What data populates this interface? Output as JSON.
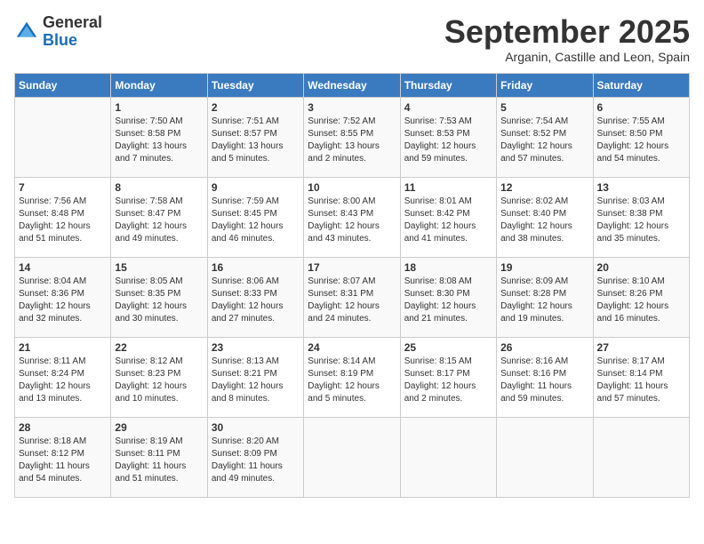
{
  "header": {
    "logo_general": "General",
    "logo_blue": "Blue",
    "month_title": "September 2025",
    "location": "Arganin, Castille and Leon, Spain"
  },
  "days_of_week": [
    "Sunday",
    "Monday",
    "Tuesday",
    "Wednesday",
    "Thursday",
    "Friday",
    "Saturday"
  ],
  "weeks": [
    [
      {
        "day": "",
        "content": ""
      },
      {
        "day": "1",
        "content": "Sunrise: 7:50 AM\nSunset: 8:58 PM\nDaylight: 13 hours\nand 7 minutes."
      },
      {
        "day": "2",
        "content": "Sunrise: 7:51 AM\nSunset: 8:57 PM\nDaylight: 13 hours\nand 5 minutes."
      },
      {
        "day": "3",
        "content": "Sunrise: 7:52 AM\nSunset: 8:55 PM\nDaylight: 13 hours\nand 2 minutes."
      },
      {
        "day": "4",
        "content": "Sunrise: 7:53 AM\nSunset: 8:53 PM\nDaylight: 12 hours\nand 59 minutes."
      },
      {
        "day": "5",
        "content": "Sunrise: 7:54 AM\nSunset: 8:52 PM\nDaylight: 12 hours\nand 57 minutes."
      },
      {
        "day": "6",
        "content": "Sunrise: 7:55 AM\nSunset: 8:50 PM\nDaylight: 12 hours\nand 54 minutes."
      }
    ],
    [
      {
        "day": "7",
        "content": "Sunrise: 7:56 AM\nSunset: 8:48 PM\nDaylight: 12 hours\nand 51 minutes."
      },
      {
        "day": "8",
        "content": "Sunrise: 7:58 AM\nSunset: 8:47 PM\nDaylight: 12 hours\nand 49 minutes."
      },
      {
        "day": "9",
        "content": "Sunrise: 7:59 AM\nSunset: 8:45 PM\nDaylight: 12 hours\nand 46 minutes."
      },
      {
        "day": "10",
        "content": "Sunrise: 8:00 AM\nSunset: 8:43 PM\nDaylight: 12 hours\nand 43 minutes."
      },
      {
        "day": "11",
        "content": "Sunrise: 8:01 AM\nSunset: 8:42 PM\nDaylight: 12 hours\nand 41 minutes."
      },
      {
        "day": "12",
        "content": "Sunrise: 8:02 AM\nSunset: 8:40 PM\nDaylight: 12 hours\nand 38 minutes."
      },
      {
        "day": "13",
        "content": "Sunrise: 8:03 AM\nSunset: 8:38 PM\nDaylight: 12 hours\nand 35 minutes."
      }
    ],
    [
      {
        "day": "14",
        "content": "Sunrise: 8:04 AM\nSunset: 8:36 PM\nDaylight: 12 hours\nand 32 minutes."
      },
      {
        "day": "15",
        "content": "Sunrise: 8:05 AM\nSunset: 8:35 PM\nDaylight: 12 hours\nand 30 minutes."
      },
      {
        "day": "16",
        "content": "Sunrise: 8:06 AM\nSunset: 8:33 PM\nDaylight: 12 hours\nand 27 minutes."
      },
      {
        "day": "17",
        "content": "Sunrise: 8:07 AM\nSunset: 8:31 PM\nDaylight: 12 hours\nand 24 minutes."
      },
      {
        "day": "18",
        "content": "Sunrise: 8:08 AM\nSunset: 8:30 PM\nDaylight: 12 hours\nand 21 minutes."
      },
      {
        "day": "19",
        "content": "Sunrise: 8:09 AM\nSunset: 8:28 PM\nDaylight: 12 hours\nand 19 minutes."
      },
      {
        "day": "20",
        "content": "Sunrise: 8:10 AM\nSunset: 8:26 PM\nDaylight: 12 hours\nand 16 minutes."
      }
    ],
    [
      {
        "day": "21",
        "content": "Sunrise: 8:11 AM\nSunset: 8:24 PM\nDaylight: 12 hours\nand 13 minutes."
      },
      {
        "day": "22",
        "content": "Sunrise: 8:12 AM\nSunset: 8:23 PM\nDaylight: 12 hours\nand 10 minutes."
      },
      {
        "day": "23",
        "content": "Sunrise: 8:13 AM\nSunset: 8:21 PM\nDaylight: 12 hours\nand 8 minutes."
      },
      {
        "day": "24",
        "content": "Sunrise: 8:14 AM\nSunset: 8:19 PM\nDaylight: 12 hours\nand 5 minutes."
      },
      {
        "day": "25",
        "content": "Sunrise: 8:15 AM\nSunset: 8:17 PM\nDaylight: 12 hours\nand 2 minutes."
      },
      {
        "day": "26",
        "content": "Sunrise: 8:16 AM\nSunset: 8:16 PM\nDaylight: 11 hours\nand 59 minutes."
      },
      {
        "day": "27",
        "content": "Sunrise: 8:17 AM\nSunset: 8:14 PM\nDaylight: 11 hours\nand 57 minutes."
      }
    ],
    [
      {
        "day": "28",
        "content": "Sunrise: 8:18 AM\nSunset: 8:12 PM\nDaylight: 11 hours\nand 54 minutes."
      },
      {
        "day": "29",
        "content": "Sunrise: 8:19 AM\nSunset: 8:11 PM\nDaylight: 11 hours\nand 51 minutes."
      },
      {
        "day": "30",
        "content": "Sunrise: 8:20 AM\nSunset: 8:09 PM\nDaylight: 11 hours\nand 49 minutes."
      },
      {
        "day": "",
        "content": ""
      },
      {
        "day": "",
        "content": ""
      },
      {
        "day": "",
        "content": ""
      },
      {
        "day": "",
        "content": ""
      }
    ]
  ]
}
